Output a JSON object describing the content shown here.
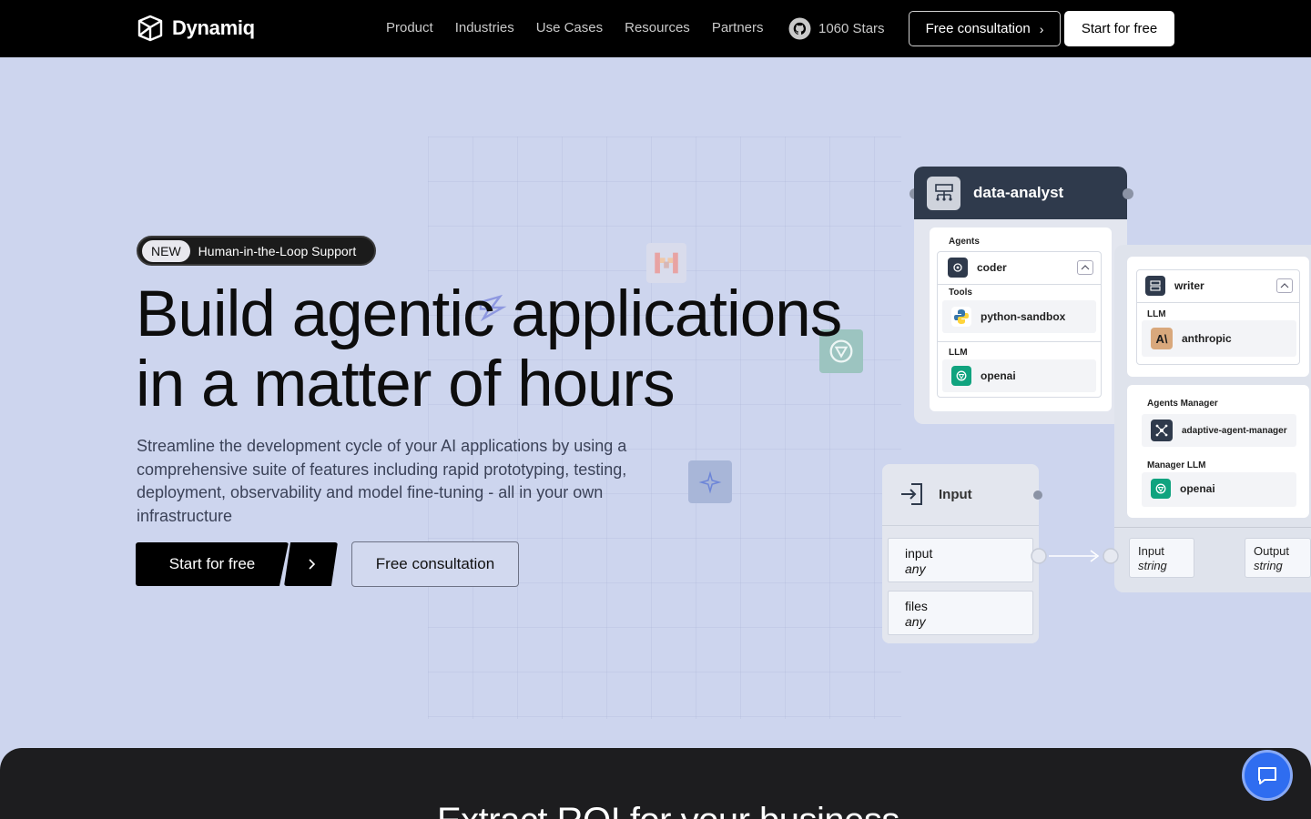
{
  "nav": {
    "logo_text": "Dynamiq",
    "links": [
      "Product",
      "Industries",
      "Use Cases",
      "Resources",
      "Partners"
    ],
    "github_stars": "1060 Stars",
    "consult_label": "Free consultation",
    "start_label": "Start for free"
  },
  "hero": {
    "badge_new": "NEW",
    "badge_text": "Human-in-the-Loop Support",
    "title_line1": "Build agentic applications",
    "title_line2": "in a matter of hours",
    "subtitle": "Streamline the development cycle of your AI applications by using a comprehensive suite of features including rapid prototyping, testing, deployment, observability and model fine-tuning - all in your own infrastructure",
    "start_label": "Start for free",
    "consult_label": "Free consultation"
  },
  "workflow": {
    "analyst": {
      "title": "data-analyst",
      "agents_label": "Agents",
      "agent": "coder",
      "tools_label": "Tools",
      "tool": "python-sandbox",
      "llm_label": "LLM",
      "llm": "openai"
    },
    "writer": {
      "agent": "writer",
      "llm_label": "LLM",
      "llm": "anthropic"
    },
    "manager": {
      "label": "Agents Manager",
      "name": "adaptive-agent-manager",
      "llm_label": "Manager LLM",
      "llm": "openai"
    },
    "input_node": {
      "title": "Input",
      "ports": [
        {
          "name": "input",
          "type": "any"
        },
        {
          "name": "files",
          "type": "any"
        }
      ]
    },
    "io": {
      "input_label": "Input",
      "input_type": "string",
      "output_label": "Output",
      "output_type": "string"
    }
  },
  "bottom": {
    "title": "Extract ROI for your business"
  },
  "colors": {
    "hero_bg": "#cdd5ee",
    "nav_bg": "#000000",
    "chat_accent": "#2f6df0",
    "openai_green": "#10a37f"
  }
}
